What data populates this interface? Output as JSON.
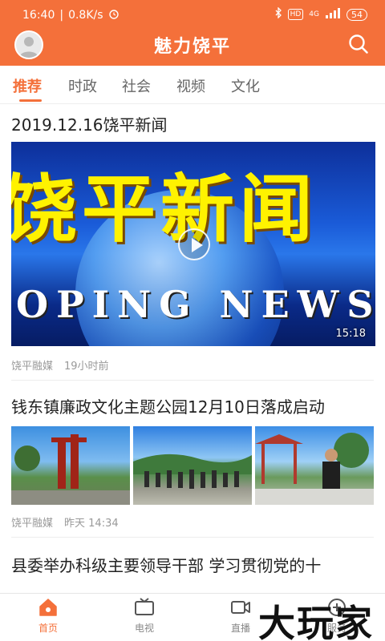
{
  "status_bar": {
    "time": "16:40",
    "speed": "0.8K/s",
    "hd_badge": "HD",
    "network": "4G",
    "battery": "54"
  },
  "header": {
    "title": "魅力饶平"
  },
  "tabs": [
    {
      "label": "推荐",
      "active": true
    },
    {
      "label": "时政",
      "active": false
    },
    {
      "label": "社会",
      "active": false
    },
    {
      "label": "视频",
      "active": false
    },
    {
      "label": "文化",
      "active": false
    }
  ],
  "feed": [
    {
      "title": "2019.12.16饶平新闻",
      "video_text": "饶平新闻",
      "video_subtext": "OPING NEWS",
      "duration": "15:18",
      "source": "饶平融媒",
      "time": "19小时前"
    },
    {
      "title": "钱东镇廉政文化主题公园12月10日落成启动",
      "source": "饶平融媒",
      "time": "昨天 14:34"
    },
    {
      "title": "县委举办科级主要领导干部 学习贯彻党的十"
    }
  ],
  "bottom_nav": [
    {
      "label": "首页",
      "icon": "home-icon",
      "active": true
    },
    {
      "label": "电视",
      "icon": "tv-icon",
      "active": false
    },
    {
      "label": "直播",
      "icon": "live-icon",
      "active": false
    },
    {
      "label": "服务",
      "icon": "service-icon",
      "active": false
    }
  ],
  "watermark": "大玩家",
  "colors": {
    "accent": "#f4703a",
    "text": "#222222",
    "meta": "#999999"
  }
}
